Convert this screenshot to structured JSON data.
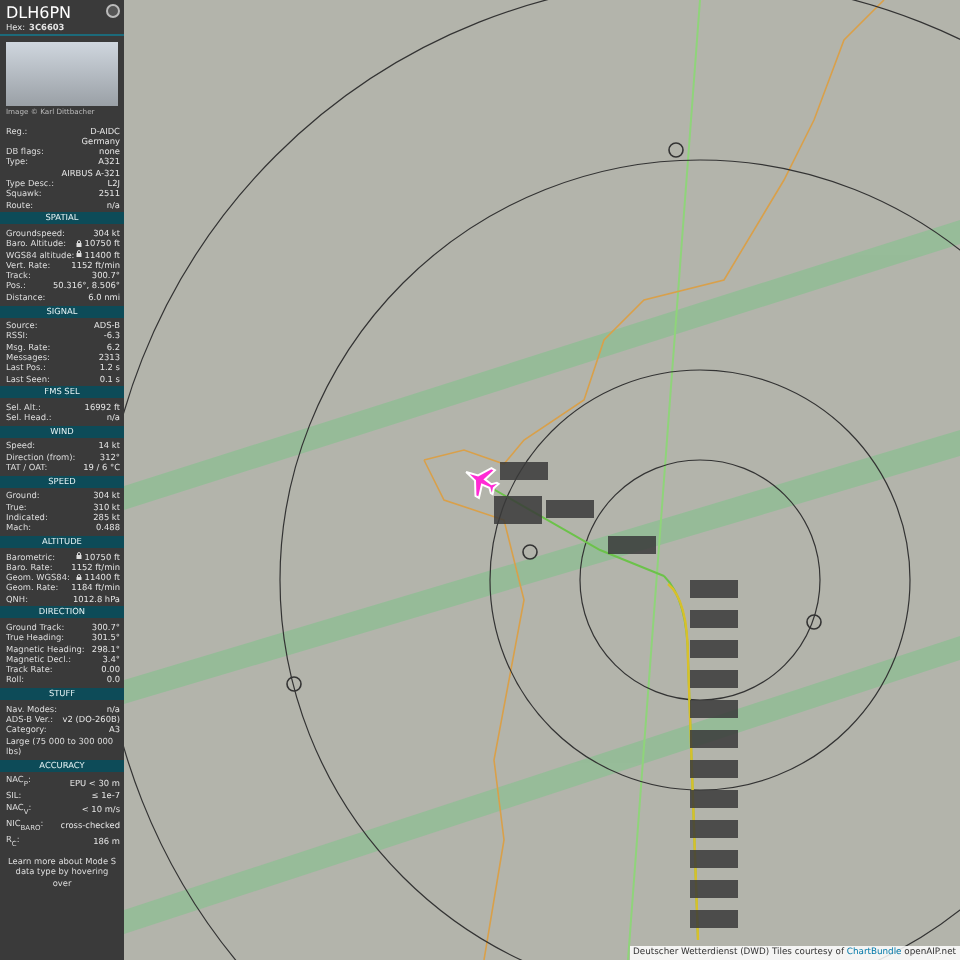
{
  "sidebar": {
    "callsign": "DLH6PN",
    "hex_label": "Hex:",
    "hex": "3C6603",
    "photo_credit": "Image © Karl Dittbacher",
    "info": [
      {
        "label": "Reg.:",
        "value": "D-AIDC"
      },
      {
        "value": "Germany"
      },
      {
        "label": "DB flags:",
        "value": "none"
      },
      {
        "label": "Type:",
        "value": "A321"
      },
      {
        "value": "AIRBUS A-321"
      },
      {
        "label": "Type Desc.:",
        "value": "L2J"
      },
      {
        "label": "Squawk:",
        "value": "2511"
      },
      {
        "label": "Route:",
        "value": "n/a"
      }
    ],
    "sections": [
      {
        "title": "SPATIAL",
        "rows": [
          {
            "label": "Groundspeed:",
            "value": "304 kt"
          },
          {
            "label": "Baro. Altitude:",
            "value": "10750 ft",
            "kind": "lock"
          },
          {
            "label": "WGS84 altitude:",
            "value": "11400 ft",
            "kind": "lock"
          },
          {
            "label": "Vert. Rate:",
            "value": "1152 ft/min"
          },
          {
            "label": "Track:",
            "value": "300.7°"
          },
          {
            "label": "Pos.:",
            "value": "50.316°, 8.506°"
          },
          {
            "label": "Distance:",
            "value": "6.0 nmi"
          }
        ]
      },
      {
        "title": "SIGNAL",
        "rows": [
          {
            "label": "Source:",
            "value": "ADS-B"
          },
          {
            "label": "RSSI:",
            "value": "-6.3"
          },
          {
            "label": "Msg. Rate:",
            "value": "6.2"
          },
          {
            "label": "Messages:",
            "value": "2313"
          },
          {
            "label": "Last Pos.:",
            "value": "1.2 s"
          },
          {
            "label": "Last Seen:",
            "value": "0.1 s"
          }
        ]
      },
      {
        "title": "FMS SEL",
        "rows": [
          {
            "label": "Sel. Alt.:",
            "value": "16992 ft"
          },
          {
            "label": "Sel. Head.:",
            "value": "n/a"
          }
        ]
      },
      {
        "title": "WIND",
        "rows": [
          {
            "label": "Speed:",
            "value": "14 kt"
          },
          {
            "label": "Direction (from):",
            "value": "312°"
          },
          {
            "label": "TAT / OAT:",
            "value": "19 / 6 °C"
          }
        ]
      },
      {
        "title": "SPEED",
        "rows": [
          {
            "label": "Ground:",
            "value": "304 kt"
          },
          {
            "label": "True:",
            "value": "310 kt"
          },
          {
            "label": "Indicated:",
            "value": "285 kt"
          },
          {
            "label": "Mach:",
            "value": "0.488"
          }
        ]
      },
      {
        "title": "ALTITUDE",
        "rows": [
          {
            "label": "Barometric:",
            "value": "10750 ft",
            "kind": "lock"
          },
          {
            "label": "Baro. Rate:",
            "value": "1152 ft/min"
          },
          {
            "label": "Geom. WGS84:",
            "value": "11400 ft",
            "kind": "lock"
          },
          {
            "label": "Geom. Rate:",
            "value": "1184 ft/min"
          },
          {
            "label": "QNH:",
            "value": "1012.8 hPa"
          }
        ]
      },
      {
        "title": "DIRECTION",
        "rows": [
          {
            "label": "Ground Track:",
            "value": "300.7°"
          },
          {
            "label": "True Heading:",
            "value": "301.5°"
          },
          {
            "label": "Magnetic Heading:",
            "value": "298.1°"
          },
          {
            "label": "Magnetic Decl.:",
            "value": "3.4°"
          },
          {
            "label": "Track Rate:",
            "value": "0.00"
          },
          {
            "label": "Roll:",
            "value": "0.0"
          }
        ]
      },
      {
        "title": "STUFF",
        "rows": [
          {
            "label": "Nav. Modes:",
            "value": "n/a"
          },
          {
            "label": "ADS-B Ver.:",
            "value": "v2 (DO-260B)"
          },
          {
            "label": "Category:",
            "value": "A3"
          },
          {
            "label": "Large (75 000 to 300 000 lbs)"
          }
        ]
      },
      {
        "title": "ACCURACY",
        "rows": [
          {
            "label": "NAC$_{P}$:",
            "value": "EPU < 30 m"
          },
          {
            "label": "SIL:",
            "value": "≤ 1e-7"
          },
          {
            "label": "NAC$_{V}$:",
            "value": "< 10 m/s"
          },
          {
            "label": "NIC$_{BARO}$:",
            "value": "cross-checked"
          },
          {
            "label": "R$_{C}$:",
            "value": "186 m"
          }
        ]
      }
    ],
    "footer": "Learn more about Mode S data type by hovering over"
  },
  "map": {
    "attribution": {
      "prefix": "Deutscher Wetterdienst (DWD) Tiles courtesy of",
      "link": "ChartBundle",
      "suffix": "openAIP.net"
    }
  }
}
